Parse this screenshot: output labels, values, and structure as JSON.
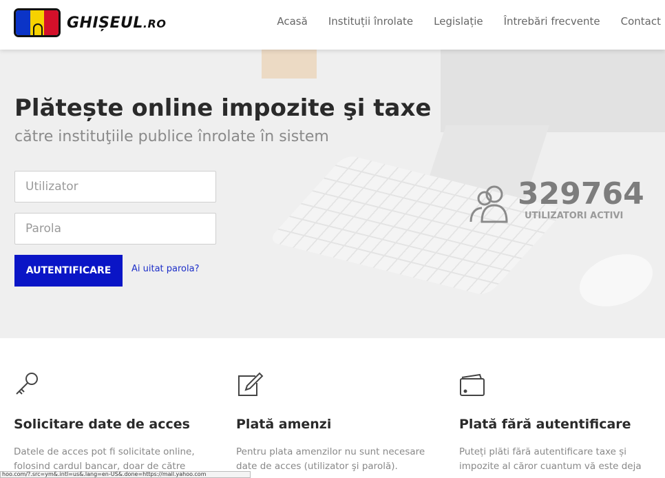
{
  "brand": {
    "name": "GHIȘEUL",
    "suffix": ".RO",
    "colors": {
      "blue": "#0b34c7",
      "yellow": "#f6d200",
      "red": "#d4102a"
    }
  },
  "nav": {
    "items": [
      "Acasă",
      "Instituții înrolate",
      "Legislație",
      "Întrebări frecvente",
      "Contact"
    ]
  },
  "hero": {
    "title": "Plătește online impozite şi taxe",
    "subtitle": "către instituţiile publice înrolate în sistem",
    "username_placeholder": "Utilizator",
    "password_placeholder": "Parola",
    "login_label": "AUTENTIFICARE",
    "forgot_label": "Ai uitat parola?",
    "active_users_count": "329764",
    "active_users_label": "UTILIZATORI ACTIVI",
    "accent": "#0a15c6"
  },
  "features": [
    {
      "icon": "key-icon",
      "title": "Solicitare date de acces",
      "text": "Datele de acces pot fi solicitate online, folosind cardul bancar, doar de către"
    },
    {
      "icon": "edit-icon",
      "title": "Plată amenzi",
      "text": "Pentru plata amenzilor nu sunt necesare date de acces (utilizator şi parolă)."
    },
    {
      "icon": "wallet-icon",
      "title": "Plată fără autentificare",
      "text": "Puteți plăti fără autentificare taxe și impozite al căror cuantum vă este deja"
    }
  ],
  "statusbar": {
    "text": "hoo.com/?.src=ym&.intl=us&.lang=en-US&.done=https://mail.yahoo.com"
  }
}
